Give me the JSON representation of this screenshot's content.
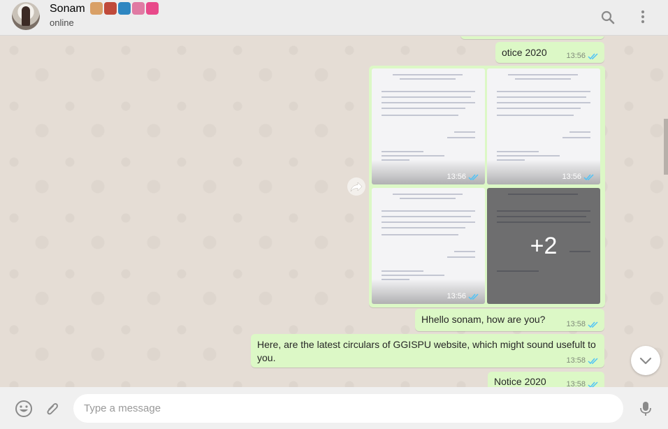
{
  "header": {
    "contact_name": "Sonam",
    "status": "online",
    "emoji_colors": [
      "#d9a066",
      "#c04a3a",
      "#2e86c1",
      "#e07aa3",
      "#e84a8a"
    ]
  },
  "messages": [
    {
      "text": "otice 2020",
      "time": "13:56"
    },
    {
      "text": "Hhello sonam, how are you?",
      "time": "13:58"
    },
    {
      "text": "Here, are the latest circulars of GGISPU website, which might sound usefult to you.",
      "time": "13:58"
    },
    {
      "text": "Notice 2020",
      "time": "13:58"
    }
  ],
  "album": {
    "times": [
      "13:56",
      "13:56",
      "13:56"
    ],
    "more_count": "+2"
  },
  "composer": {
    "placeholder": "Type a message"
  },
  "colors": {
    "bubble": "#dcf8c6",
    "read_tick": "#4fc3f7",
    "chat_bg": "#e5ddd5"
  }
}
